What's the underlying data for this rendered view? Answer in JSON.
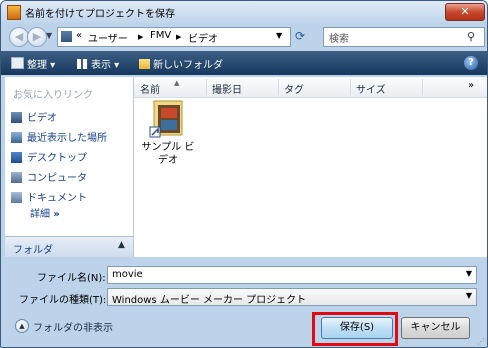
{
  "window": {
    "title": "名前を付けてプロジェクトを保存",
    "close_label": "✕"
  },
  "address": {
    "prefix": "«",
    "segments": [
      "ユーザー",
      "FMV",
      "ビデオ"
    ],
    "separator": "▶"
  },
  "search": {
    "placeholder": "検索"
  },
  "toolbar": {
    "organize": "整理",
    "views": "表示",
    "new_folder": "新しいフォルダ",
    "help": "?"
  },
  "nav": {
    "heading": "お気に入りリンク",
    "items": [
      {
        "label": "ビデオ",
        "icon": "video-icon"
      },
      {
        "label": "最近表示した場所",
        "icon": "recent-places-icon"
      },
      {
        "label": "デスクトップ",
        "icon": "desktop-icon"
      },
      {
        "label": "コンピュータ",
        "icon": "computer-icon"
      },
      {
        "label": "ドキュメント",
        "icon": "documents-icon"
      }
    ],
    "more": "詳細",
    "more_arrow": "»",
    "folders_label": "フォルダ"
  },
  "columns": [
    "名前",
    "撮影日",
    "タグ",
    "サイズ"
  ],
  "files": [
    {
      "line1": "サンプル ビ",
      "line2": "デオ"
    }
  ],
  "filename": {
    "label": "ファイル名(N):",
    "value": "movie"
  },
  "filetype": {
    "label": "ファイルの種類(T):",
    "value": "Windows ムービー メーカー プロジェクト"
  },
  "hide_folders": "フォルダの非表示",
  "buttons": {
    "save": "保存(S)",
    "cancel": "キャンセル"
  },
  "colors": {
    "highlight": "#e10a14",
    "toolbar": "#16385e",
    "link": "#15418c"
  }
}
